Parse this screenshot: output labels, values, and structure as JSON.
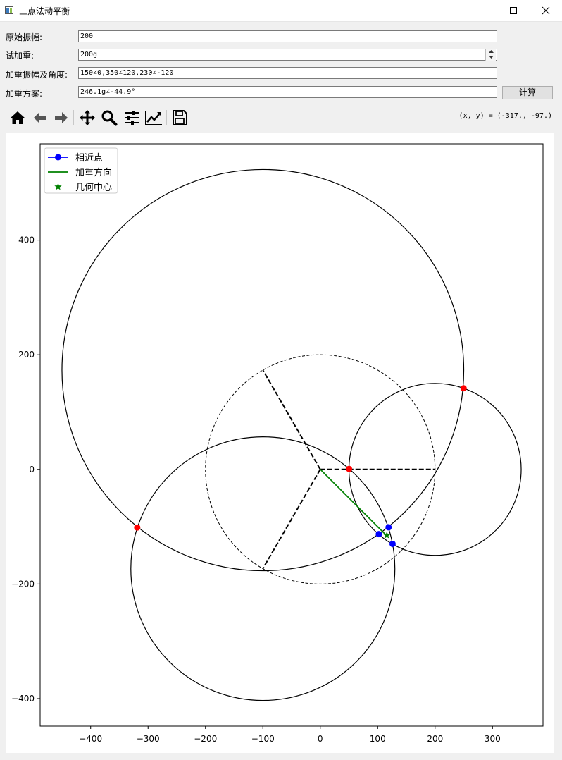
{
  "window": {
    "title": "三点法动平衡",
    "minimize_icon": "minimize-icon",
    "maximize_icon": "maximize-icon",
    "close_icon": "close-icon"
  },
  "form": {
    "amplitude_label": "原始振幅:",
    "amplitude_value": "200",
    "trial_weight_label": "试加重:",
    "trial_weight_value": "200g",
    "weighted_label": "加重振幅及角度:",
    "weighted_value": "150∠0,350∠120,230∠-120",
    "plan_label": "加重方案:",
    "plan_value": "246.1g∠-44.9°",
    "calc_button": "计算"
  },
  "toolbar": {
    "items": [
      "home-icon",
      "back-icon",
      "forward-icon",
      "pan-icon",
      "zoom-icon",
      "configure-subplots-icon",
      "edit-axis-icon",
      "save-icon"
    ],
    "coords": "(x, y) = (-317., -97.)"
  },
  "chart_data": {
    "type": "scatter",
    "xlim": [
      -488,
      388
    ],
    "ylim": [
      -448,
      568
    ],
    "xticks": [
      -400,
      -300,
      -200,
      -100,
      0,
      100,
      200,
      300
    ],
    "yticks": [
      -400,
      -200,
      0,
      200,
      400
    ],
    "grid": false,
    "legend_position": "upper-left",
    "legend": [
      {
        "label": "相近点",
        "style": "line-dot",
        "color": "#0000ff"
      },
      {
        "label": "加重方向",
        "style": "line",
        "color": "#008000"
      },
      {
        "label": "几何中心",
        "style": "star",
        "color": "#008000"
      }
    ],
    "reference_circle": {
      "cx": 0,
      "cy": 0,
      "r": 200,
      "style": "dashed"
    },
    "circles": [
      {
        "cx": 200,
        "cy": 0,
        "r": 150
      },
      {
        "cx": -100,
        "cy": 173.2,
        "r": 350
      },
      {
        "cx": -100,
        "cy": -173.2,
        "r": 230
      }
    ],
    "spokes": [
      [
        200,
        0
      ],
      [
        -100,
        173.2
      ],
      [
        -100,
        -173.2
      ]
    ],
    "intersection_points": [
      [
        249.7,
        141.5
      ],
      [
        -318.9,
        -101.4
      ],
      [
        50.1,
        0.8
      ]
    ],
    "near_points": [
      [
        119,
        -101
      ],
      [
        102,
        -113
      ],
      [
        126,
        -130
      ]
    ],
    "weight_direction": [
      [
        0,
        0
      ],
      [
        115,
        -115
      ]
    ],
    "geometric_center": [
      116,
      -115
    ]
  }
}
